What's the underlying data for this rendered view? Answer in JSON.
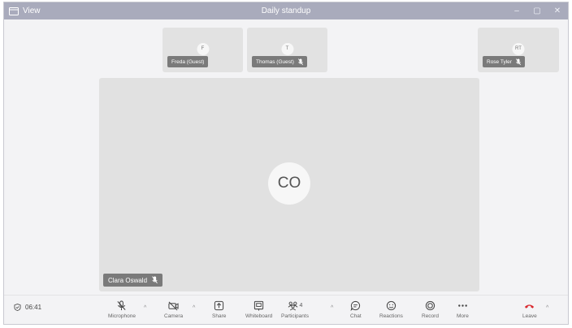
{
  "titlebar": {
    "view_label": "View",
    "title": "Daily standup",
    "minimize": "–",
    "maximize": "▢",
    "close": "✕"
  },
  "participants": [
    {
      "initials": "F",
      "name": "Freda (Guest)",
      "muted": false
    },
    {
      "initials": "T",
      "name": "Thomas (Guest)",
      "muted": true
    },
    {
      "initials": "RT",
      "name": "Rose Tyler",
      "muted": true
    }
  ],
  "speaker": {
    "initials": "CO",
    "name": "Clara Oswald",
    "muted": true
  },
  "toolbar": {
    "timer": "06:41",
    "microphone": "Microphone",
    "camera": "Camera",
    "share": "Share",
    "whiteboard": "Whiteboard",
    "participants": "Participants",
    "participant_count": "4",
    "chat": "Chat",
    "reactions": "Reactions",
    "record": "Record",
    "more": "More",
    "leave": "Leave",
    "caret": "^"
  },
  "colors": {
    "leave": "#d9262c",
    "titlebar": "#a9abbc"
  }
}
